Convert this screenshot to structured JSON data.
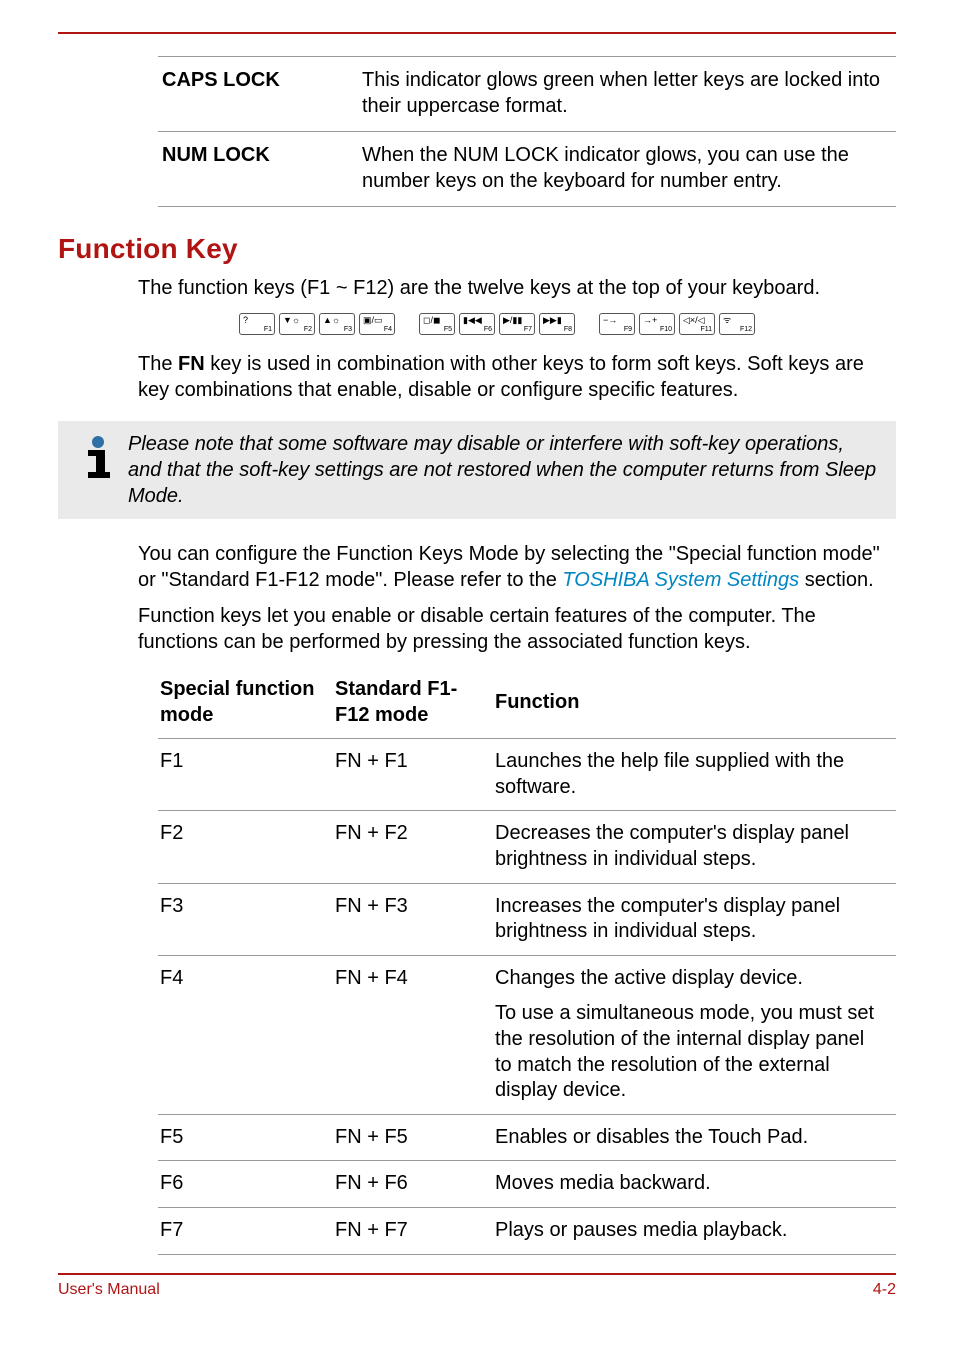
{
  "lock_table": [
    {
      "term": "CAPS LOCK",
      "desc": "This indicator glows green when letter keys are locked into their uppercase format."
    },
    {
      "term": "NUM LOCK",
      "desc": "When the NUM LOCK indicator glows, you can use the number keys on the keyboard for number entry."
    }
  ],
  "heading": "Function Key",
  "para1": "The function keys (F1 ~ F12) are the twelve keys at the top of your keyboard.",
  "kbd_keys": [
    {
      "group": 0,
      "sym": "?",
      "lbl": "F1"
    },
    {
      "group": 0,
      "sym": "▼☼",
      "lbl": "F2"
    },
    {
      "group": 0,
      "sym": "▲☼",
      "lbl": "F3"
    },
    {
      "group": 0,
      "sym": "▣/▭",
      "lbl": "F4"
    },
    {
      "group": 1,
      "sym": "◻/◼",
      "lbl": "F5"
    },
    {
      "group": 1,
      "sym": "▮◀◀",
      "lbl": "F6"
    },
    {
      "group": 1,
      "sym": "▶/▮▮",
      "lbl": "F7"
    },
    {
      "group": 1,
      "sym": "▶▶▮",
      "lbl": "F8"
    },
    {
      "group": 2,
      "sym": "−→",
      "lbl": "F9"
    },
    {
      "group": 2,
      "sym": "→+",
      "lbl": "F10"
    },
    {
      "group": 2,
      "sym": "◁×/◁",
      "lbl": "F11"
    },
    {
      "group": 2,
      "sym": "ᯤ",
      "lbl": "F12"
    }
  ],
  "para2_pre": "The ",
  "para2_bold": "FN",
  "para2_post": " key is used in combination with other keys to form soft keys. Soft keys are key combinations that enable, disable or configure specific features.",
  "note_text": "Please note that some software may disable or interfere with soft-key operations, and that the soft-key settings are not restored when the computer returns from Sleep Mode.",
  "para3_pre": "You can configure the Function Keys Mode by selecting the \"Special function mode\" or \"Standard F1-F12 mode\". Please refer to the ",
  "para3_link": "TOSHIBA System Settings",
  "para3_post": " section.",
  "para4": "Function keys let you enable or disable certain features of the computer. The functions can be performed by pressing the associated function keys.",
  "fk_headers": {
    "col1": "Special function mode",
    "col2": "Standard F1-F12 mode",
    "col3": "Function"
  },
  "fk_rows": [
    {
      "c1": "F1",
      "c2": "FN + F1",
      "c3": [
        "Launches the help file supplied with the software."
      ]
    },
    {
      "c1": "F2",
      "c2": "FN + F2",
      "c3": [
        "Decreases the computer's display panel brightness in individual steps."
      ]
    },
    {
      "c1": "F3",
      "c2": "FN + F3",
      "c3": [
        "Increases the computer's display panel brightness in individual steps."
      ]
    },
    {
      "c1": "F4",
      "c2": "FN + F4",
      "c3": [
        "Changes the active display device.",
        "To use a simultaneous mode, you must set the resolution of the internal display panel to match the resolution of the external display device."
      ]
    },
    {
      "c1": "F5",
      "c2": "FN + F5",
      "c3": [
        "Enables or disables the Touch Pad."
      ]
    },
    {
      "c1": "F6",
      "c2": "FN + F6",
      "c3": [
        "Moves media backward."
      ]
    },
    {
      "c1": "F7",
      "c2": "FN + F7",
      "c3": [
        "Plays or pauses media playback."
      ]
    }
  ],
  "footer": {
    "left": "User's Manual",
    "right": "4-2"
  }
}
